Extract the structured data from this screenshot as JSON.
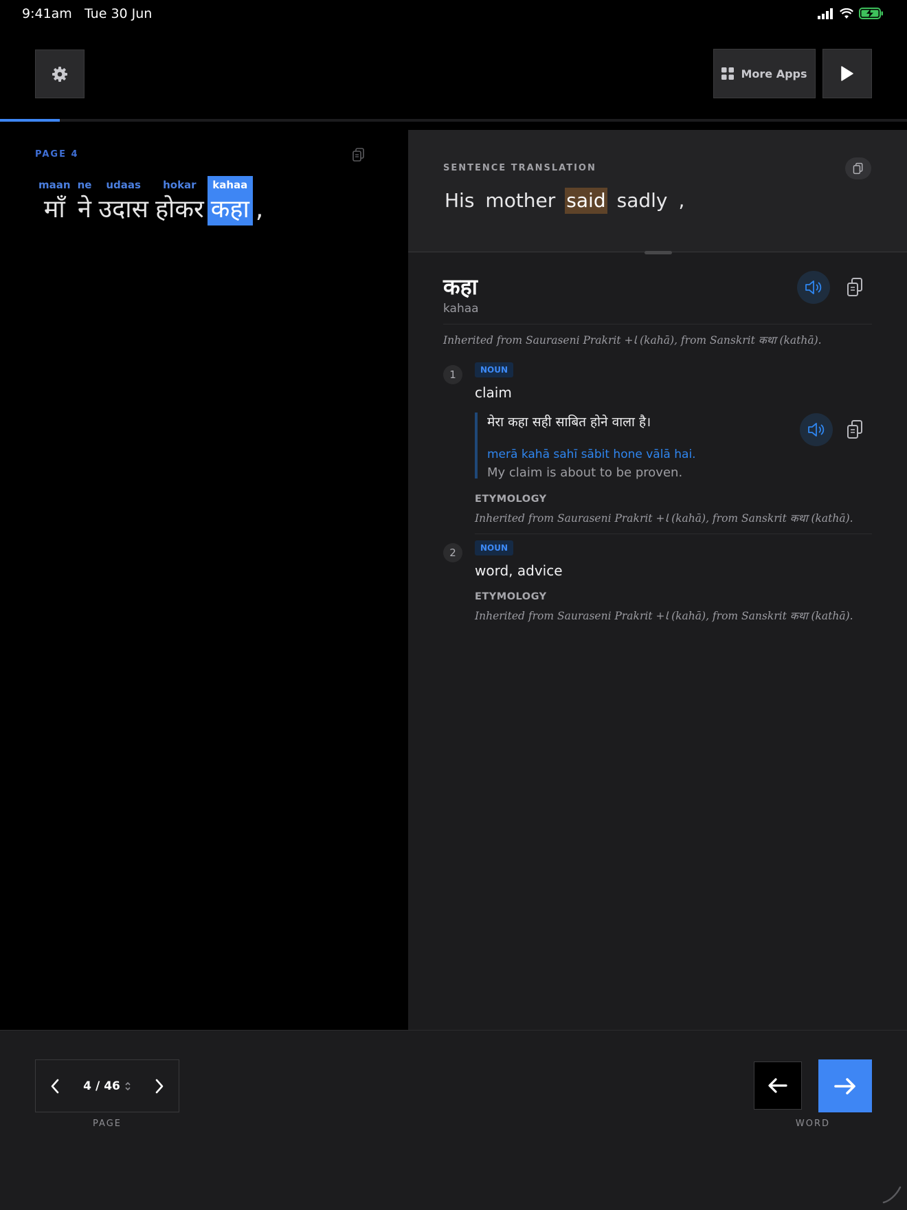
{
  "status_bar": {
    "time": "9:41am",
    "date": "Tue 30 Jun",
    "icons": [
      "signal-icon",
      "wifi-icon",
      "battery-charging-icon"
    ]
  },
  "toolbar": {
    "more_apps_label": "More Apps",
    "icons": [
      "gear-icon",
      "grid-icon",
      "play-icon"
    ]
  },
  "progress": {
    "fraction": 0.066
  },
  "reader": {
    "page_label": "PAGE 4",
    "words": [
      {
        "translit": "maan",
        "devanagari": "माँ",
        "active": false
      },
      {
        "translit": "ne",
        "devanagari": "ने",
        "active": false
      },
      {
        "translit": "udaas",
        "devanagari": "उदास",
        "active": false
      },
      {
        "translit": "hokar",
        "devanagari": "होकर",
        "active": false
      },
      {
        "translit": "kahaa",
        "devanagari": "कहा",
        "active": true
      }
    ],
    "punctuation": ","
  },
  "translation": {
    "label": "SENTENCE TRANSLATION",
    "words": [
      {
        "text": "His",
        "highlight": false
      },
      {
        "text": "mother",
        "highlight": false
      },
      {
        "text": "said",
        "highlight": true
      },
      {
        "text": "sadly",
        "highlight": false
      },
      {
        "text": ",",
        "highlight": false
      }
    ]
  },
  "dictionary": {
    "headword": "कहा",
    "translit": "kahaa",
    "etymology": "Inherited from Sauraseni Prakrit +ﺎ (kahā), from Sanskrit कथा (kathā).",
    "senses": [
      {
        "number": "1",
        "pos": "NOUN",
        "gloss": "claim",
        "example_hindi": "मेरा कहा सही साबित होने वाला है।",
        "example_roman": "merā kahā sahī sābit hone vālā hai.",
        "example_english": "My claim is about to be proven.",
        "etymology_label": "ETYMOLOGY",
        "etymology": "Inherited from Sauraseni Prakrit +ﺎ (kahā), from Sanskrit कथा (kathā)."
      },
      {
        "number": "2",
        "pos": "NOUN",
        "gloss": "word, advice",
        "etymology_label": "ETYMOLOGY",
        "etymology": "Inherited from Sauraseni Prakrit +ﺎ (kahā), from Sanskrit कथा (kathā)."
      }
    ]
  },
  "bottom": {
    "current_page": "4",
    "separator": "/",
    "total_pages": "46",
    "page_caption": "PAGE",
    "word_caption": "WORD"
  },
  "colors": {
    "accent": "#3e86f4",
    "translit": "#4b7fe0",
    "highlight_translation": "#5e4329",
    "panel": "#1c1c1e"
  }
}
